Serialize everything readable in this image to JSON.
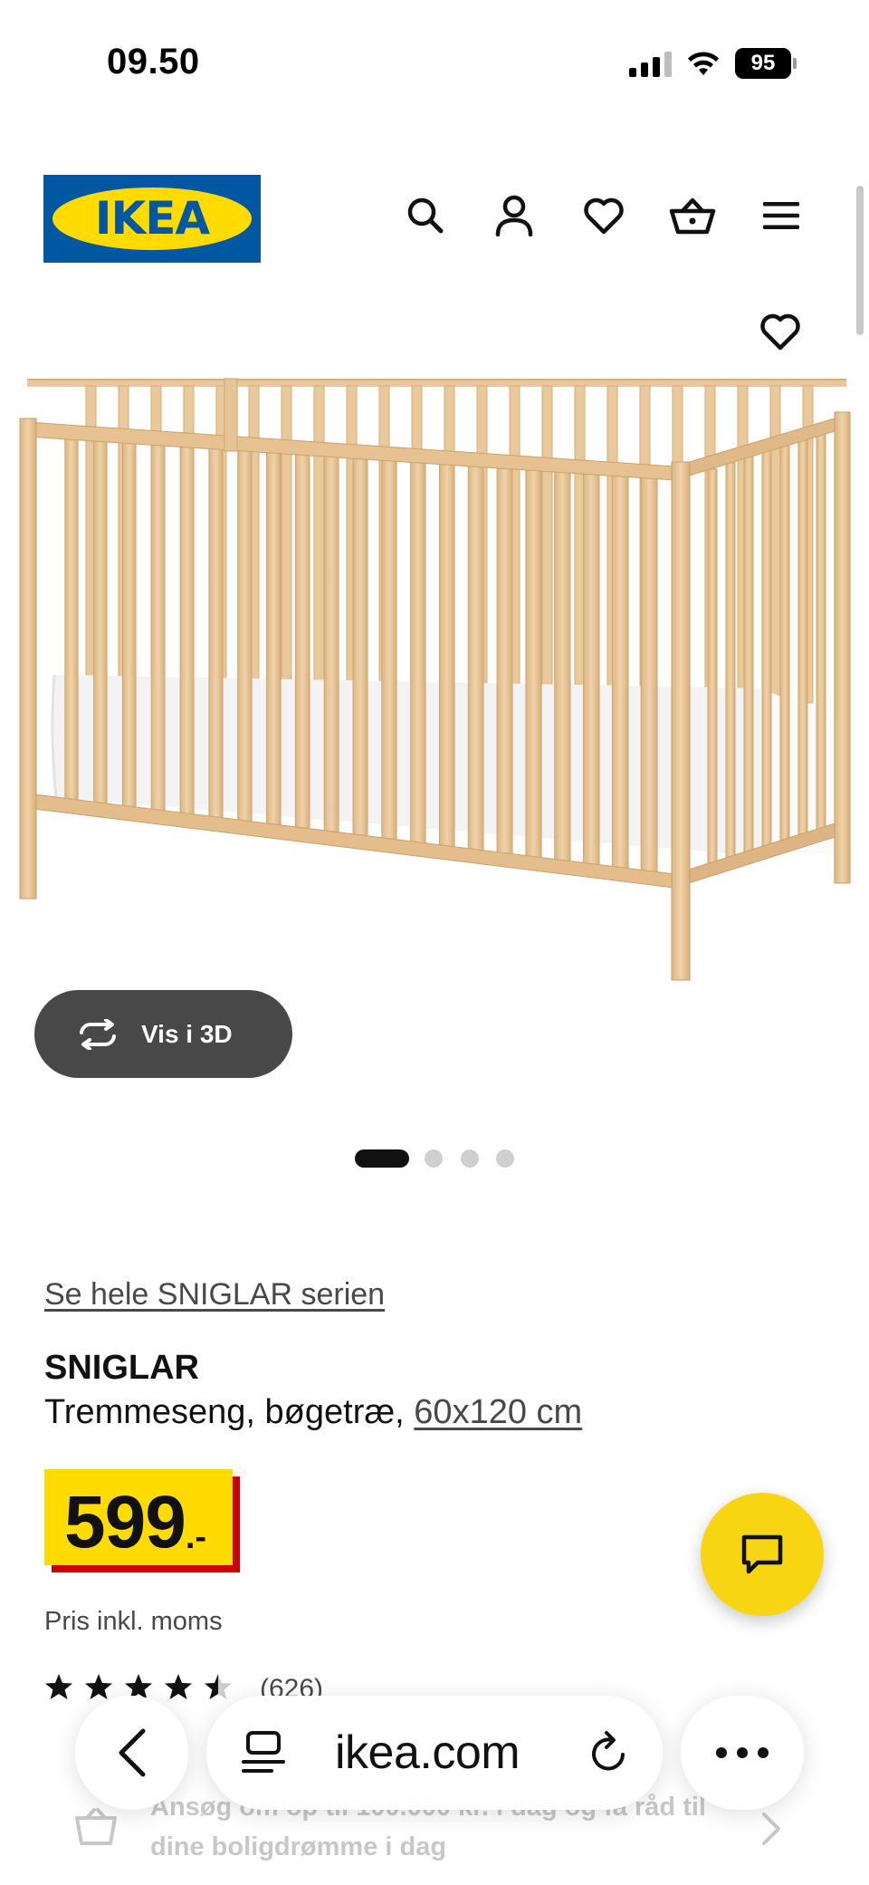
{
  "status_bar": {
    "time": "09.50",
    "battery_level": "95"
  },
  "header": {
    "logo_text": "IKEA",
    "icons": [
      "search-icon",
      "account-icon",
      "heart-icon",
      "basket-icon",
      "menu-icon"
    ]
  },
  "gallery": {
    "view_3d_label": "Vis i 3D",
    "image_count": 4,
    "active_index": 0
  },
  "product": {
    "series_link": "Se hele SNIGLAR serien",
    "name": "SNIGLAR",
    "description": "Tremmeseng, bøgetræ,",
    "size_link": "60x120 cm",
    "price_integer": "599",
    "price_suffix": ".-",
    "price_note": "Pris inkl. moms",
    "rating_value": 4.5,
    "rating_count": "(626)"
  },
  "promo": {
    "text": "Ansøg om op til 100.000 kr. i dag og få råd til dine boligdrømme i dag"
  },
  "browser": {
    "url": "ikea.com"
  },
  "colors": {
    "ikea_blue": "#0058a3",
    "ikea_yellow": "#ffdb00",
    "price_red": "#cc0008",
    "chat_yellow": "#f7d513",
    "dark_button": "#484848"
  }
}
